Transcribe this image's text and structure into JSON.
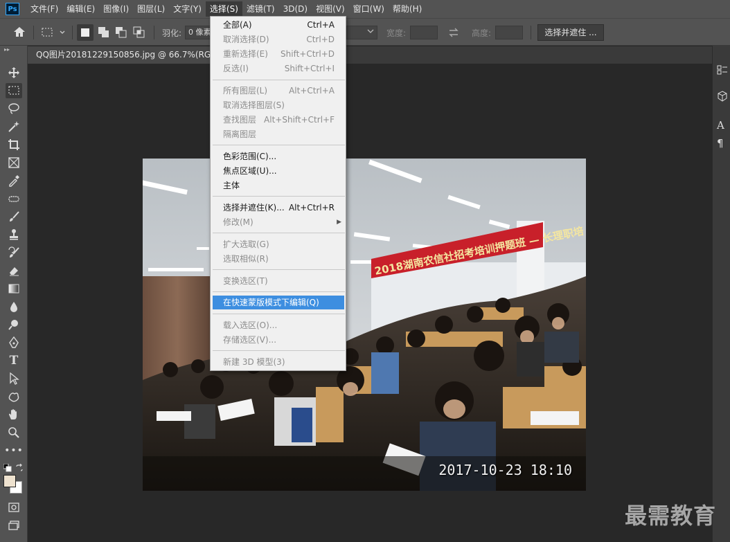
{
  "menubar": {
    "logo": "Ps",
    "items": [
      "文件(F)",
      "编辑(E)",
      "图像(I)",
      "图层(L)",
      "文字(Y)",
      "选择(S)",
      "滤镜(T)",
      "3D(D)",
      "视图(V)",
      "窗口(W)",
      "帮助(H)"
    ],
    "active_index": 5
  },
  "options": {
    "feather_label": "羽化:",
    "feather_value": "0 像素",
    "width_label": "宽度:",
    "height_label": "高度:",
    "select_mask_button": "选择并遮住 ..."
  },
  "document": {
    "tab_title": "QQ图片20181229150856.jpg @ 66.7%(RGB/8#",
    "photo_timestamp": "2017-10-23 18:10",
    "banner_text": "2018湖南农信社招考培训押题班 — 长理职培"
  },
  "watermark": "最需教育",
  "select_menu": {
    "items": [
      {
        "label": "全部(A)",
        "shortcut": "Ctrl+A",
        "enabled": true
      },
      {
        "label": "取消选择(D)",
        "shortcut": "Ctrl+D",
        "enabled": false
      },
      {
        "label": "重新选择(E)",
        "shortcut": "Shift+Ctrl+D",
        "enabled": false
      },
      {
        "label": "反选(I)",
        "shortcut": "Shift+Ctrl+I",
        "enabled": false
      },
      {
        "label": "所有图层(L)",
        "shortcut": "Alt+Ctrl+A",
        "enabled": false
      },
      {
        "label": "取消选择图层(S)",
        "shortcut": "",
        "enabled": false
      },
      {
        "label": "查找图层",
        "shortcut": "Alt+Shift+Ctrl+F",
        "enabled": false
      },
      {
        "label": "隔离图层",
        "shortcut": "",
        "enabled": false
      },
      {
        "label": "色彩范围(C)...",
        "shortcut": "",
        "enabled": true
      },
      {
        "label": "焦点区域(U)...",
        "shortcut": "",
        "enabled": true
      },
      {
        "label": "主体",
        "shortcut": "",
        "enabled": true
      },
      {
        "label": "选择并遮住(K)...",
        "shortcut": "Alt+Ctrl+R",
        "enabled": true
      },
      {
        "label": "修改(M)",
        "shortcut": "",
        "enabled": false,
        "submenu": true
      },
      {
        "label": "扩大选取(G)",
        "shortcut": "",
        "enabled": false
      },
      {
        "label": "选取相似(R)",
        "shortcut": "",
        "enabled": false
      },
      {
        "label": "变换选区(T)",
        "shortcut": "",
        "enabled": false
      },
      {
        "label": "在快速蒙版模式下编辑(Q)",
        "shortcut": "",
        "enabled": true,
        "highlighted": true
      },
      {
        "label": "载入选区(O)...",
        "shortcut": "",
        "enabled": false
      },
      {
        "label": "存储选区(V)...",
        "shortcut": "",
        "enabled": false
      },
      {
        "label": "新建 3D 模型(3)",
        "shortcut": "",
        "enabled": false
      }
    ]
  },
  "right_panel": {
    "char_icon_text": "A",
    "para_icon_text": "¶"
  },
  "colors": {
    "highlight": "#3d8ee0",
    "menubar_bg": "#535353",
    "canvas_bg": "#282828",
    "banner_red": "#c8202a"
  }
}
